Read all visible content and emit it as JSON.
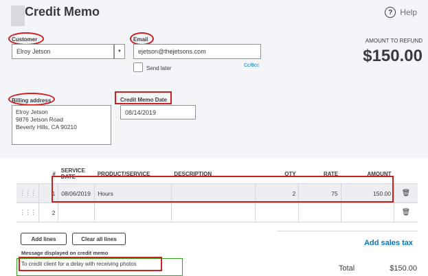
{
  "header": {
    "title": "Credit Memo",
    "help_label": "Help",
    "help_icon": "?"
  },
  "customer": {
    "label": "Customer",
    "value": "Elroy Jetson",
    "dropdown_icon": "chevron-down-icon"
  },
  "email": {
    "label": "Email",
    "value": "ejetson@thejetsons.com",
    "send_later_label": "Send later",
    "cc_bcc_label": "Cc/Bcc"
  },
  "amount": {
    "label": "AMOUNT TO REFUND",
    "value": "$150.00"
  },
  "billing": {
    "label": "Billing address",
    "lines": [
      "Elroy Jetson",
      "9876 Jetson Road",
      "Beverly Hills, CA 90210"
    ]
  },
  "memo_date": {
    "label": "Credit Memo Date",
    "value": "08/14/2019"
  },
  "table": {
    "headers": {
      "num": "#",
      "service_date": "SERVICE DATE",
      "product": "PRODUCT/SERVICE",
      "description": "DESCRIPTION",
      "qty": "QTY",
      "rate": "RATE",
      "amount": "AMOUNT"
    },
    "rows": [
      {
        "num": "1",
        "service_date": "08/06/2019",
        "product": "Hours",
        "description": "",
        "qty": "2",
        "rate": "75",
        "amount": "150.00"
      },
      {
        "num": "2",
        "service_date": "",
        "product": "",
        "description": "",
        "qty": "",
        "rate": "",
        "amount": ""
      }
    ]
  },
  "buttons": {
    "add_lines": "Add lines",
    "clear_all_lines": "Clear all lines"
  },
  "message": {
    "label": "Message displayed on credit memo",
    "value": "To credit client for a delay with receiving photos"
  },
  "totals": {
    "add_sales_tax": "Add sales tax",
    "total_label": "Total",
    "total_value": "$150.00"
  },
  "annotation_color": "#cc1f1f"
}
